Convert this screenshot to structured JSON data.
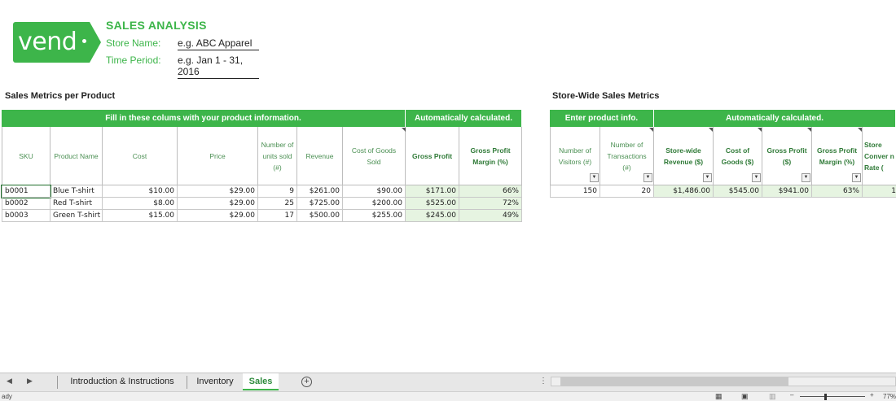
{
  "header": {
    "logo": "vend",
    "title": "SALES ANALYSIS",
    "store_label": "Store Name:",
    "store_value": "e.g. ABC Apparel",
    "period_label": "Time Period:",
    "period_value": "e.g. Jan 1 - 31, 2016"
  },
  "product_section": {
    "title": "Sales Metrics per Product",
    "banner_fill": "Fill in these colums with your product information.",
    "banner_auto": "Automatically calculated.",
    "columns": [
      "SKU",
      "Product Name",
      "Cost",
      "Price",
      "Number of units sold (#)",
      "Revenue",
      "Cost of Goods Sold",
      "Gross Profit",
      "Gross Profit Margin (%)"
    ],
    "rows": [
      [
        "b0001",
        "Blue T-shirt",
        "$10.00",
        "$29.00",
        "9",
        "$261.00",
        "$90.00",
        "$171.00",
        "66%"
      ],
      [
        "b0002",
        "Red T-shirt",
        "$8.00",
        "$29.00",
        "25",
        "$725.00",
        "$200.00",
        "$525.00",
        "72%"
      ],
      [
        "b0003",
        "Green T-shirt",
        "$15.00",
        "$29.00",
        "17",
        "$500.00",
        "$255.00",
        "$245.00",
        "49%"
      ]
    ]
  },
  "store_section": {
    "title": "Store-Wide Sales Metrics",
    "banner_enter": "Enter product info.",
    "banner_auto": "Automatically calculated.",
    "columns": [
      "Number of Visitors (#)",
      "Number of Transactions (#)",
      "Store-wide Revenue ($)",
      "Cost of Goods ($)",
      "Gross Profit ($)",
      "Gross Profit Margin (%)",
      "Store Conver n Rate ("
    ],
    "row": [
      "150",
      "20",
      "$1,486.00",
      "$545.00",
      "$941.00",
      "63%",
      "1"
    ]
  },
  "sheet_tabs": [
    {
      "label": "Introduction & Instructions",
      "active": false
    },
    {
      "label": "Inventory",
      "active": false
    },
    {
      "label": "Sales",
      "active": true
    }
  ],
  "status": {
    "ready": "ady",
    "zoom": "77%"
  },
  "colors": {
    "brand": "#3db54a",
    "calc_fill": "#e6f4e1"
  }
}
